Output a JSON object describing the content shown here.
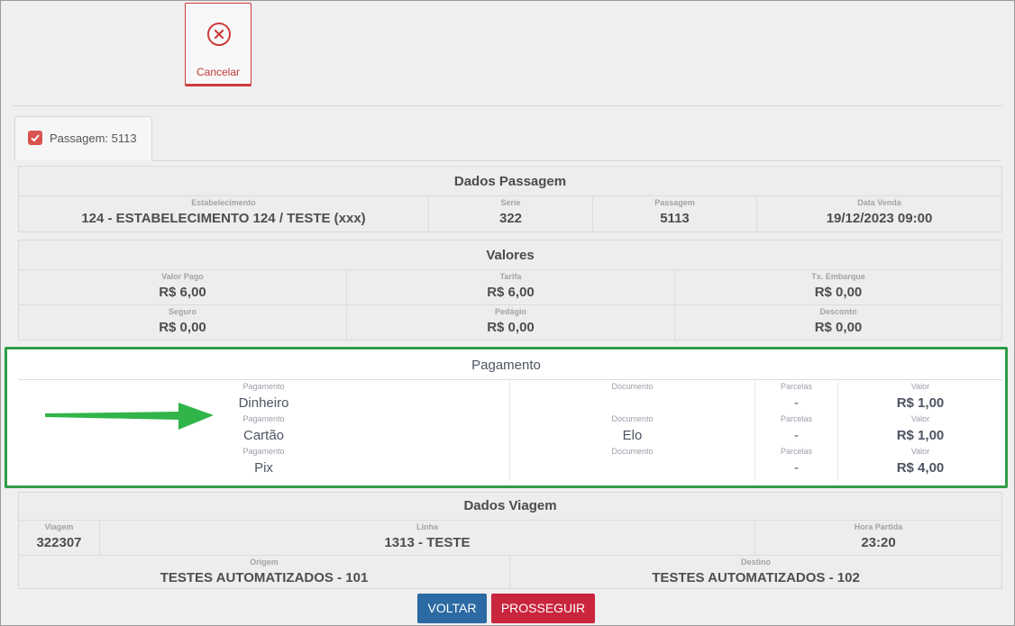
{
  "toolbar": {
    "cancel_label": "Cancelar"
  },
  "tab": {
    "label": "Passagem: 5113"
  },
  "dados_passagem": {
    "title": "Dados Passagem",
    "fields": [
      {
        "label": "Estabelecimento",
        "value": "124 - ESTABELECIMENTO 124 / TESTE (xxx)"
      },
      {
        "label": "Serie",
        "value": "322"
      },
      {
        "label": "Passagem",
        "value": "5113"
      },
      {
        "label": "Data Venda",
        "value": "19/12/2023 09:00"
      }
    ]
  },
  "valores": {
    "title": "Valores",
    "fields": [
      {
        "label": "Valor Pago",
        "value": "R$ 6,00"
      },
      {
        "label": "Tarifa",
        "value": "R$ 6,00"
      },
      {
        "label": "Tx. Embarque",
        "value": "R$ 0,00"
      },
      {
        "label": "Seguro",
        "value": "R$ 0,00"
      },
      {
        "label": "Pedágio",
        "value": "R$ 0,00"
      },
      {
        "label": "Desconto",
        "value": "R$ 0,00"
      }
    ]
  },
  "pagamento": {
    "title": "Pagamento",
    "labels": {
      "pagamento": "Pagamento",
      "documento": "Documento",
      "parcelas": "Parcelas",
      "valor": "Valor"
    },
    "rows": [
      {
        "pagamento": "Dinheiro",
        "documento": "",
        "parcelas": "-",
        "valor": "R$ 1,00"
      },
      {
        "pagamento": "Cartão",
        "documento": "Elo",
        "parcelas": "-",
        "valor": "R$ 1,00"
      },
      {
        "pagamento": "Pix",
        "documento": "",
        "parcelas": "-",
        "valor": "R$ 4,00"
      }
    ]
  },
  "dados_viagem": {
    "title": "Dados Viagem",
    "fields": [
      {
        "label": "Viagem",
        "value": "322307"
      },
      {
        "label": "Linha",
        "value": "1313 - TESTE"
      },
      {
        "label": "Hora Partida",
        "value": "23:20"
      },
      {
        "label": "Origem",
        "value": "TESTES AUTOMATIZADOS - 101"
      },
      {
        "label": "Destino",
        "value": "TESTES AUTOMATIZADOS - 102"
      }
    ]
  },
  "actions": {
    "back_label": "VOLTAR",
    "proceed_label": "PROSSEGUIR"
  },
  "colors": {
    "highlight": "#2f9d47",
    "cancel": "#cf3b3b",
    "back": "#2b6aa3",
    "proceed": "#c9253d",
    "arrow": "#31b449"
  }
}
